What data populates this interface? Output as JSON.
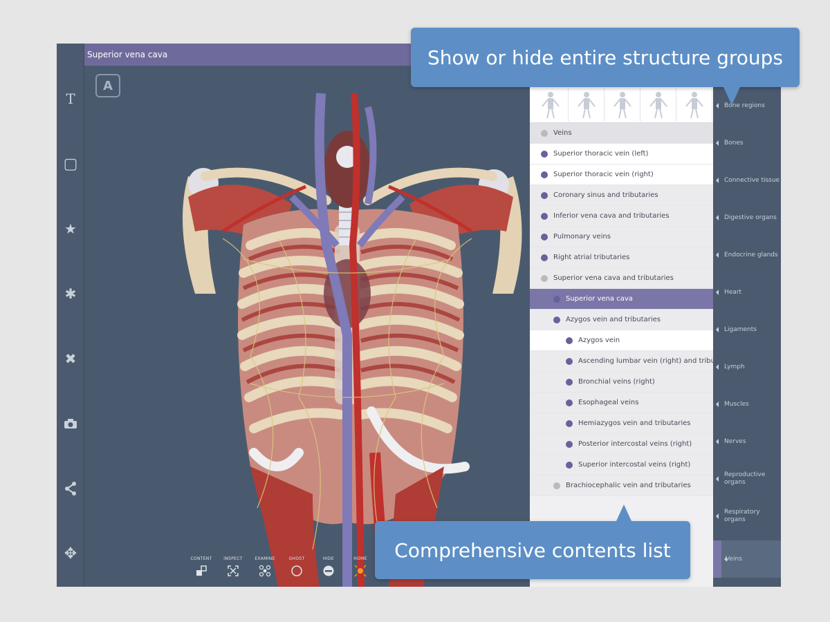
{
  "viewer": {
    "title": "Superior vena cava",
    "view_cube_letter": "A"
  },
  "left_toolbar": [
    {
      "icon": "text-icon",
      "glyph": "T"
    },
    {
      "icon": "box-select-icon",
      "glyph": "▢"
    },
    {
      "icon": "star-icon",
      "glyph": "★"
    },
    {
      "icon": "gear-icon",
      "glyph": "✱"
    },
    {
      "icon": "scissors-icon",
      "glyph": "✖"
    },
    {
      "icon": "camera-icon",
      "glyph": "⌷"
    },
    {
      "icon": "share-icon",
      "glyph": "<"
    },
    {
      "icon": "move-icon",
      "glyph": "✥"
    }
  ],
  "bottom_tools": [
    {
      "label": "CONTENT",
      "icon": "content-icon"
    },
    {
      "label": "INSPECT",
      "icon": "inspect-icon"
    },
    {
      "label": "EXAMINE",
      "icon": "examine-icon"
    },
    {
      "label": "GHOST",
      "icon": "ghost-icon"
    },
    {
      "label": "HIDE",
      "icon": "hide-icon"
    },
    {
      "label": "HOME",
      "icon": "home-icon"
    }
  ],
  "contents": {
    "group_header": "Veins",
    "items": [
      {
        "label": "Superior thoracic vein (left)",
        "level": 1,
        "style": "white",
        "dot": "purple"
      },
      {
        "label": "Superior thoracic vein (right)",
        "level": 1,
        "style": "white",
        "dot": "purple"
      },
      {
        "label": "Coronary sinus and tributaries",
        "level": 1,
        "style": "grey",
        "dot": "purple"
      },
      {
        "label": "Inferior vena cava and tributaries",
        "level": 1,
        "style": "grey",
        "dot": "purple"
      },
      {
        "label": "Pulmonary veins",
        "level": 1,
        "style": "grey",
        "dot": "purple"
      },
      {
        "label": "Right atrial tributaries",
        "level": 1,
        "style": "grey",
        "dot": "purple"
      },
      {
        "label": "Superior vena cava and tributaries",
        "level": 1,
        "style": "grey",
        "dot": "grey"
      },
      {
        "label": "Superior vena cava",
        "level": 2,
        "style": "selected",
        "dot": "purple"
      },
      {
        "label": "Azygos vein and tributaries",
        "level": 2,
        "style": "grey",
        "dot": "purple"
      },
      {
        "label": "Azygos vein",
        "level": 3,
        "style": "white",
        "dot": "purple"
      },
      {
        "label": "Ascending lumbar vein (right) and tributaries",
        "level": 3,
        "style": "grey",
        "dot": "purple"
      },
      {
        "label": "Bronchial veins (right)",
        "level": 3,
        "style": "grey",
        "dot": "purple"
      },
      {
        "label": "Esophageal veins",
        "level": 3,
        "style": "grey",
        "dot": "purple"
      },
      {
        "label": "Hemiazygos vein and tributaries",
        "level": 3,
        "style": "grey",
        "dot": "purple"
      },
      {
        "label": "Posterior intercostal veins (right)",
        "level": 3,
        "style": "grey",
        "dot": "purple"
      },
      {
        "label": "Superior intercostal veins (right)",
        "level": 3,
        "style": "grey",
        "dot": "purple"
      },
      {
        "label": "Brachiocephalic vein and tributaries",
        "level": 2,
        "style": "grey",
        "dot": "grey"
      }
    ]
  },
  "categories": [
    {
      "label": "Bone regions",
      "active": false
    },
    {
      "label": "Bones",
      "active": false
    },
    {
      "label": "Connective tissue",
      "active": false
    },
    {
      "label": "Digestive organs",
      "active": false
    },
    {
      "label": "Endocrine glands",
      "active": false
    },
    {
      "label": "Heart",
      "active": false
    },
    {
      "label": "Ligaments",
      "active": false
    },
    {
      "label": "Lymph",
      "active": false
    },
    {
      "label": "Muscles",
      "active": false
    },
    {
      "label": "Nerves",
      "active": false
    },
    {
      "label": "Reproductive organs",
      "active": false
    },
    {
      "label": "Respiratory organs",
      "active": false
    },
    {
      "label": "Veins",
      "active": true
    }
  ],
  "callouts": {
    "top": "Show or hide entire structure groups",
    "bottom": "Comprehensive contents list"
  },
  "colors": {
    "accent_purple": "#7b76a8",
    "callout_blue": "#5d8fc6",
    "toolbar_slate": "#4b5a6e"
  }
}
